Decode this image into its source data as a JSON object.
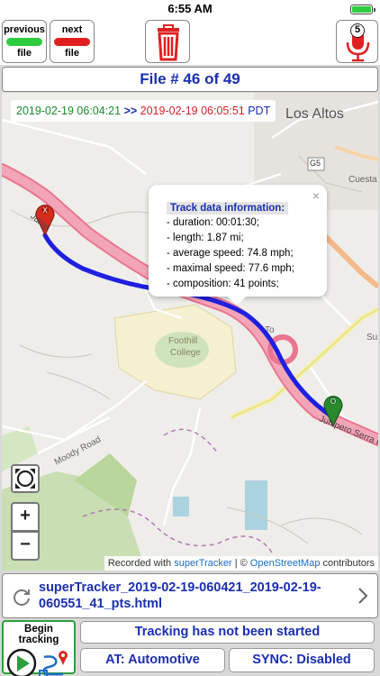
{
  "status_bar": {
    "time": "6:55 AM"
  },
  "toolbar": {
    "previous": {
      "top": "previous",
      "bottom": "file",
      "color": "#2ecc40"
    },
    "next": {
      "top": "next",
      "bottom": "file",
      "color": "#e02020"
    },
    "trash_icon": "trash-icon",
    "mic_icon": "microphone-icon",
    "mic_badge": "5"
  },
  "file_counter": "File # 46 of 49",
  "map": {
    "time_start": "2019-02-19 06:04:21",
    "time_arrow": ">>",
    "time_end": "2019-02-19 06:05:51",
    "timezone": "PDT",
    "places": {
      "los_altos": "Los Altos",
      "g5": "G5",
      "cuesta": "Cuesta",
      "foothill": "Foothill",
      "college": "College",
      "moody": "Moody Road",
      "junipero": "Junipero Serra F",
      "to": "To",
      "su": "Su",
      "junipero_left": "Junip"
    },
    "start_marker": "O",
    "end_marker": "X",
    "popup": {
      "title": "Track data information:",
      "lines": [
        "- duration: 00:01:30;",
        "- length: 1.87 mi;",
        "- average speed: 74.8 mph;",
        "- maximal speed: 77.6 mph;",
        "- composition: 41 points;"
      ],
      "close": "×"
    },
    "zoom_in": "+",
    "zoom_out": "−",
    "attribution": {
      "recorded": "Recorded with",
      "supertracker": "superTracker",
      "sep": "| ©",
      "osm": "OpenStreetMap",
      "contributors": "contributors"
    }
  },
  "file_link": {
    "name": "superTracker_2019-02-19-060421_2019-02-19-060551_41_pts.html"
  },
  "tracking": {
    "begin_label": "Begin tracking",
    "status": "Tracking has not been started",
    "mode": "AT: Automotive",
    "sync": "SYNC: Disabled"
  }
}
